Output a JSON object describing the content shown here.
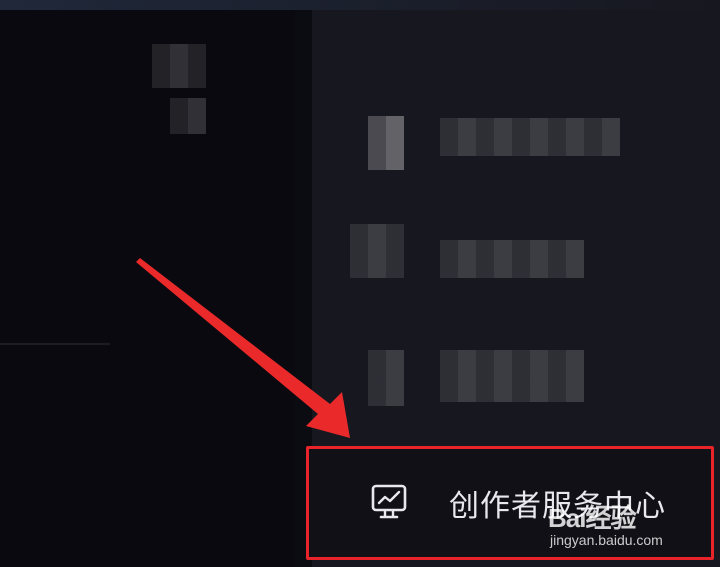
{
  "menu": {
    "creator_center": {
      "label": "创作者服务中心",
      "icon": "monitor-chart-icon"
    }
  },
  "highlight": {
    "color": "#e8242a"
  },
  "watermark": {
    "logo": "Bai经验",
    "url": "jingyan.baidu.com"
  }
}
